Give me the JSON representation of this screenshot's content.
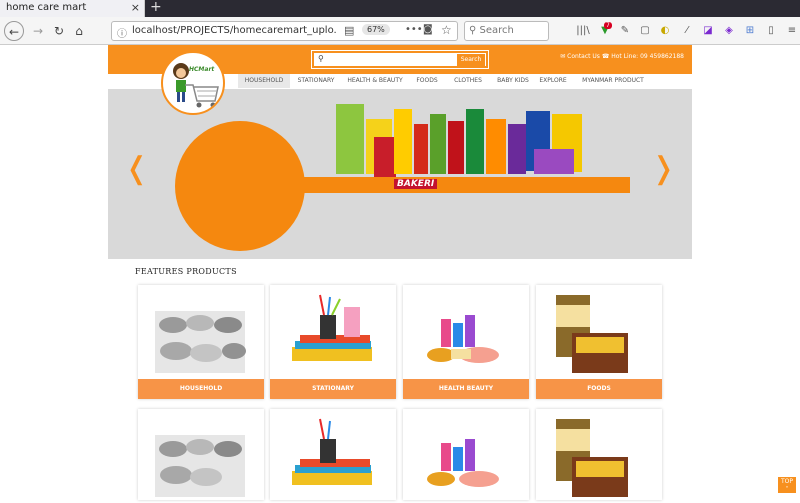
{
  "browser": {
    "tab_title": "home care mart",
    "tab_close": "×",
    "new_tab": "+",
    "url": "localhost/PROJECTS/homecaremart_uplo...",
    "zoom": "67%",
    "search_placeholder": "Search",
    "badge_count": "7"
  },
  "site": {
    "logo_text": "HCMart",
    "search_button": "Search",
    "contact": "✉ Contact Us   ☎ Hot Line: 09 459862188",
    "menu": [
      "HOUSEHOLD",
      "STATIONARY",
      "HEALTH & BEAUTY",
      "FOODS",
      "CLOTHES",
      "BABY KIDS",
      "EXPLORE",
      "MYANMAR PRODUCT"
    ],
    "slider_brand": "BAKERI",
    "features_title": "FEATURES PRODUCTS",
    "cards": [
      {
        "label": "HOUSEHOLD"
      },
      {
        "label": "STATIONARY"
      },
      {
        "label": "HEALTH BEAUTY"
      },
      {
        "label": "FOODS"
      }
    ],
    "top_button": "TOP"
  }
}
